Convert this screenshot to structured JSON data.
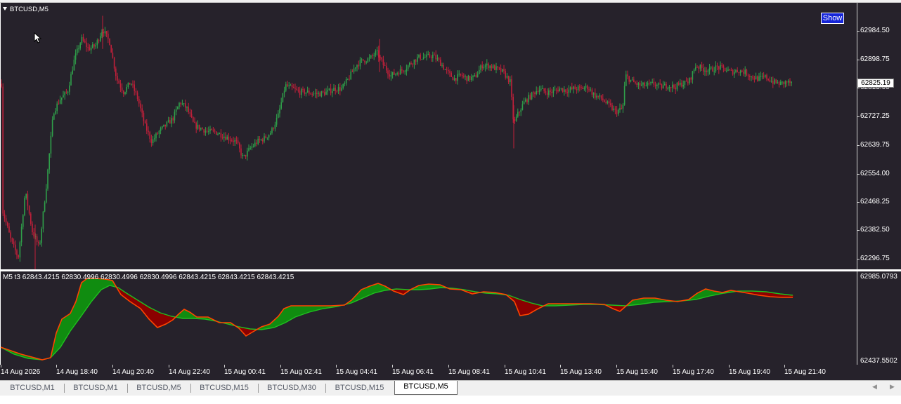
{
  "chart": {
    "symbol": "BTCUSD,M5",
    "show_button": "Show",
    "current_price": "62825.19",
    "price_ticks": [
      "62984.50",
      "62898.75",
      "62813.00",
      "62727.25",
      "62639.75",
      "62554.00",
      "62468.25",
      "62382.50",
      "62296.75"
    ],
    "time_ticks": [
      "14 Aug 2026",
      "14 Aug 18:40",
      "14 Aug 20:40",
      "14 Aug 22:40",
      "15 Aug 00:41",
      "15 Aug 02:41",
      "15 Aug 04:41",
      "15 Aug 06:41",
      "15 Aug 08:41",
      "15 Aug 10:41",
      "15 Aug 13:40",
      "15 Aug 15:40",
      "15 Aug 17:40",
      "15 Aug 19:40",
      "15 Aug 21:40"
    ],
    "colors": {
      "background": "#26222b",
      "bull": "#2fa04a",
      "bear": "#c0203a",
      "fast_line": "#ff4500",
      "slow_line": "#20c020",
      "fill_up": "#108c10",
      "fill_down": "#8b0000"
    }
  },
  "indicator": {
    "label": "M5 t3  62843.4215 62830.4996 62830.4996 62830.4996 62843.4215 62843.4215 62843.4215",
    "axis_top": "62985.0793",
    "axis_bottom": "62437.5502"
  },
  "tabs": [
    {
      "label": "BTCUSD,M1",
      "active": false
    },
    {
      "label": "BTCUSD,M1",
      "active": false
    },
    {
      "label": "BTCUSD,M5",
      "active": false
    },
    {
      "label": "BTCUSD,M15",
      "active": false
    },
    {
      "label": "BTCUSD,M30",
      "active": false
    },
    {
      "label": "BTCUSD,M15",
      "active": false
    },
    {
      "label": "BTCUSD,M5",
      "active": true
    }
  ],
  "chart_data": {
    "type": "candlestick",
    "series_outline_price": {
      "time": [
        "14 Aug 2026",
        "14 Aug 18:40",
        "14 Aug 20:40",
        "14 Aug 22:40",
        "15 Aug 00:41",
        "15 Aug 02:41",
        "15 Aug 04:41",
        "15 Aug 06:41",
        "15 Aug 08:41",
        "15 Aug 10:41",
        "15 Aug 13:40",
        "15 Aug 15:40",
        "15 Aug 17:40",
        "15 Aug 19:40",
        "15 Aug 21:40"
      ],
      "close": [
        62340,
        62960,
        62790,
        62700,
        62620,
        62800,
        62910,
        62905,
        62860,
        62735,
        62810,
        62830,
        62870,
        62870,
        62825.19
      ]
    },
    "ylim": [
      62260,
      63070
    ]
  }
}
